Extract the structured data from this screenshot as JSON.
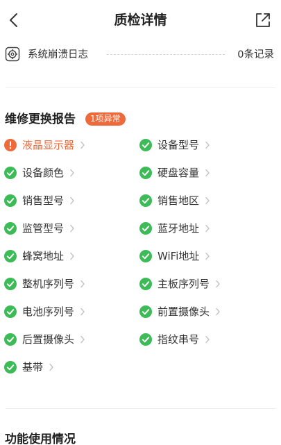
{
  "header": {
    "title": "质检详情"
  },
  "crash_log": {
    "label": "系统崩溃日志",
    "count": "0条记录"
  },
  "repair_report": {
    "title": "维修更换报告",
    "badge": "1项异常",
    "items": [
      {
        "label": "液晶显示器",
        "status": "abnormal"
      },
      {
        "label": "设备型号",
        "status": "ok"
      },
      {
        "label": "设备颜色",
        "status": "ok"
      },
      {
        "label": "硬盘容量",
        "status": "ok"
      },
      {
        "label": "销售型号",
        "status": "ok"
      },
      {
        "label": "销售地区",
        "status": "ok"
      },
      {
        "label": "监管型号",
        "status": "ok"
      },
      {
        "label": "蓝牙地址",
        "status": "ok"
      },
      {
        "label": "蜂窝地址",
        "status": "ok"
      },
      {
        "label": "WiFi地址",
        "status": "ok"
      },
      {
        "label": "整机序列号",
        "status": "ok"
      },
      {
        "label": "主板序列号",
        "status": "ok"
      },
      {
        "label": "电池序列号",
        "status": "ok"
      },
      {
        "label": "前置摄像头",
        "status": "ok"
      },
      {
        "label": "后置摄像头",
        "status": "ok"
      },
      {
        "label": "指纹串号",
        "status": "ok"
      },
      {
        "label": "基带",
        "status": "ok"
      }
    ]
  },
  "function_usage": {
    "title": "功能使用情况"
  },
  "colors": {
    "ok": "#3cbb57",
    "abnormal": "#ee6a3b",
    "text": "#333333"
  }
}
